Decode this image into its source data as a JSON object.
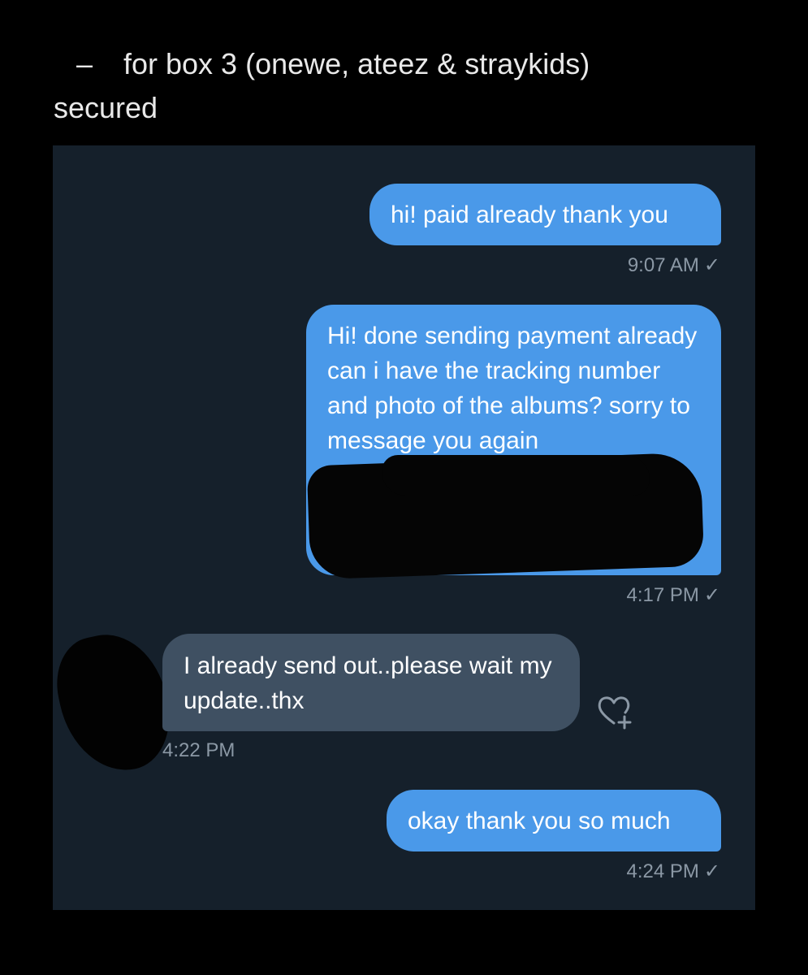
{
  "caption": {
    "dash": "–",
    "line1": "for box 3 (onewe, ateez & straykids)",
    "line2": "secured"
  },
  "messages": [
    {
      "direction": "outgoing",
      "text": "hi! paid already thank you",
      "time": "9:07 AM",
      "status": "✓"
    },
    {
      "direction": "outgoing",
      "text": "Hi! done sending payment already can i have the tracking number and photo of the albums? sorry to message you again",
      "time": "4:17 PM",
      "status": "✓"
    },
    {
      "direction": "incoming",
      "text": "I already send out..please wait my update..thx",
      "time": "4:22 PM",
      "status": ""
    },
    {
      "direction": "outgoing",
      "text": "okay thank you so much",
      "time": "4:24 PM",
      "status": "✓"
    }
  ],
  "icons": {
    "like": "heart-plus-icon",
    "read": "checkmark-icon"
  },
  "colors": {
    "background": "#000000",
    "panel": "#15202b",
    "outgoing_bubble": "#4a99e9",
    "incoming_bubble": "#3f5062",
    "timestamp": "#8b98a5"
  }
}
